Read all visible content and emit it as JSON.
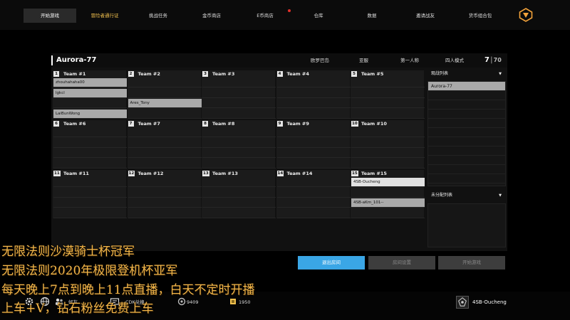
{
  "nav": {
    "items": [
      {
        "label": "开始游戏",
        "active": true
      },
      {
        "label": "冒险者通行证",
        "highlight": true
      },
      {
        "label": "挑战任务"
      },
      {
        "label": "金币商店"
      },
      {
        "label": "E币商店",
        "badge": true
      },
      {
        "label": "仓库"
      },
      {
        "label": "数据"
      },
      {
        "label": "邀请战友"
      },
      {
        "label": "货币组合包"
      }
    ]
  },
  "lobby": {
    "room_name": "Aurora-77",
    "map": "欧罗巴岛",
    "region": "亚服",
    "perspective": "第一人称",
    "mode": "四人模式",
    "player_count": "7",
    "max_players": "70",
    "teams": [
      {
        "num": "1",
        "name": "Team #1",
        "players": [
          "zhouhahaha00",
          "lgkcl",
          "",
          "LaiBunWong"
        ]
      },
      {
        "num": "2",
        "name": "Team #2",
        "players": [
          "",
          "",
          "Ares_Tony",
          ""
        ]
      },
      {
        "num": "3",
        "name": "Team #3",
        "players": [
          "",
          "",
          "",
          ""
        ]
      },
      {
        "num": "4",
        "name": "Team #4",
        "players": [
          "",
          "",
          "",
          ""
        ]
      },
      {
        "num": "5",
        "name": "Team #5",
        "players": [
          "",
          "",
          "",
          ""
        ]
      },
      {
        "num": "6",
        "name": "Team #6",
        "players": [
          "",
          "",
          "",
          ""
        ]
      },
      {
        "num": "7",
        "name": "Team #7",
        "players": [
          "",
          "",
          "",
          ""
        ]
      },
      {
        "num": "8",
        "name": "Team #8",
        "players": [
          "",
          "",
          "",
          ""
        ]
      },
      {
        "num": "9",
        "name": "Team #9",
        "players": [
          "",
          "",
          "",
          ""
        ]
      },
      {
        "num": "10",
        "name": "Team #10",
        "players": [
          "",
          "",
          "",
          ""
        ]
      },
      {
        "num": "11",
        "name": "Team #11",
        "players": [
          "",
          "",
          "",
          ""
        ]
      },
      {
        "num": "12",
        "name": "Team #12",
        "players": [
          "",
          "",
          "",
          ""
        ]
      },
      {
        "num": "13",
        "name": "Team #13",
        "players": [
          "",
          "",
          "",
          ""
        ]
      },
      {
        "num": "14",
        "name": "Team #14",
        "players": [
          "",
          "",
          "",
          ""
        ]
      },
      {
        "num": "15",
        "name": "Team #15",
        "players": [
          "4SB-Oucheng",
          "",
          "4SB-aKm_101--",
          ""
        ]
      }
    ],
    "spectators_label": "观战列表",
    "spectators": [
      "Aurora-77"
    ],
    "unassigned_label": "未分配列表",
    "unassigned": []
  },
  "buttons": {
    "leave_room": "退出房间",
    "room_settings": "房间设置",
    "start_game": "开始游戏"
  },
  "bottombar": {
    "friends_label": "好友",
    "cdk_label": "CDK兑换",
    "bp_amount": "9409",
    "gcoin_amount": "1950",
    "username": "4SB-Oucheng"
  },
  "overlay": {
    "line1": "无限法则沙漠骑士杯冠军",
    "line2": "无限法则2020年极限登机杯亚军",
    "line3": "每天晚上7点到晚上11点直播，白天不定时开播",
    "line4": "上车+V，钻石粉丝免费上车"
  },
  "colors": {
    "accent": "#3aa6e6",
    "highlight": "#f2c14e",
    "overlay_text": "#f4b74a"
  }
}
